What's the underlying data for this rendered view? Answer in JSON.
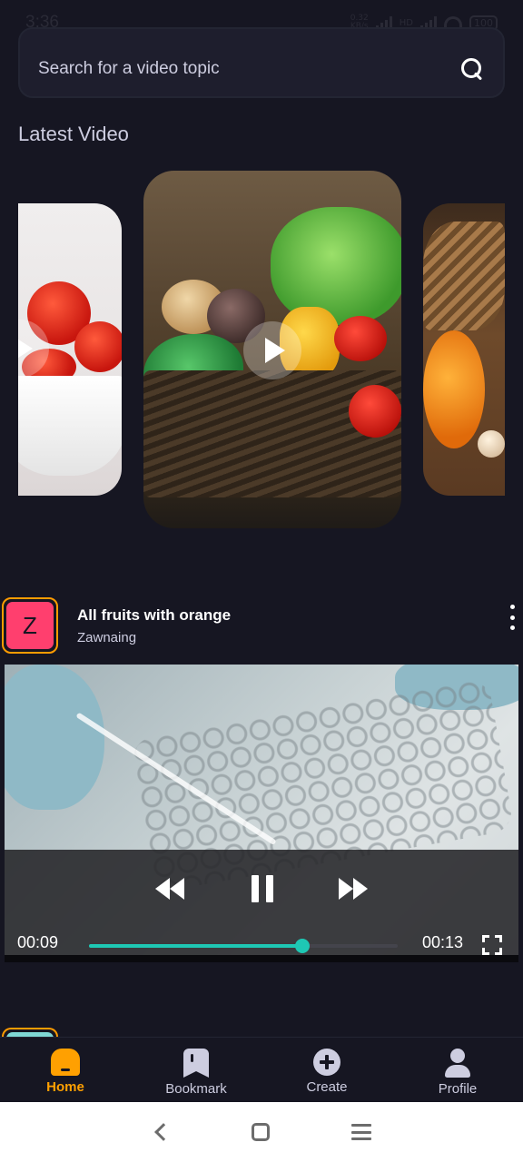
{
  "status_bar": {
    "time": "3:36",
    "net_speed_value": "0.32",
    "net_speed_unit": "KB/s",
    "signal_label": "HD",
    "battery": "100"
  },
  "search": {
    "placeholder": "Search for a video topic"
  },
  "latest_section": {
    "title": "Latest Video",
    "cards": [
      {
        "subject": "tomatoes"
      },
      {
        "subject": "vegetable-basket"
      },
      {
        "subject": "pumpkin"
      }
    ]
  },
  "video_post": {
    "avatar_initial": "Z",
    "title": "All fruits with orange",
    "author": "Zawnaing",
    "player": {
      "current_time": "00:09",
      "total_time": "00:13",
      "progress": 0.69
    }
  },
  "tabbar": {
    "tabs": [
      {
        "label": "Home",
        "icon": "home-icon",
        "active": true
      },
      {
        "label": "Bookmark",
        "icon": "bookmark-icon",
        "active": false
      },
      {
        "label": "Create",
        "icon": "plus-circle-icon",
        "active": false
      },
      {
        "label": "Profile",
        "icon": "profile-icon",
        "active": false
      }
    ]
  },
  "colors": {
    "background": "#161622",
    "accent": "#ffa001",
    "avatar": "#ff3f6e",
    "progress": "#1ec8b4"
  }
}
